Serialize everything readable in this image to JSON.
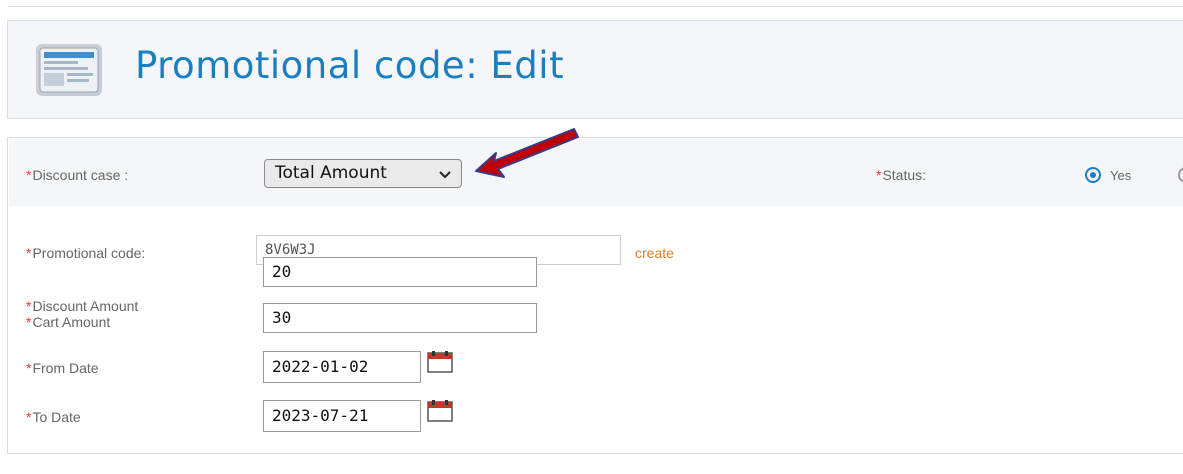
{
  "header": {
    "title": "Promotional code: Edit",
    "icon": "form-page-icon"
  },
  "form": {
    "required_marker": "*",
    "discount_case": {
      "label": "Discount case :",
      "selected": "Total Amount"
    },
    "status": {
      "label": "Status:",
      "options": [
        "Yes"
      ],
      "selected": "Yes"
    },
    "promo_code": {
      "label": "Promotional code:",
      "value": "8V6W3J",
      "create_label": "create"
    },
    "discount_amount": {
      "label": "Discount Amount",
      "value": "20"
    },
    "cart_amount": {
      "label": "Cart Amount",
      "value": "30"
    },
    "from_date": {
      "label": "From Date",
      "value": "2022-01-02",
      "icon": "calendar-icon"
    },
    "to_date": {
      "label": "To Date",
      "value": "2023-07-21",
      "icon": "calendar-icon"
    }
  },
  "annotation": {
    "type": "arrow",
    "color": "#c00000"
  },
  "colors": {
    "accent": "#1a7fc1",
    "required": "#e43b3b",
    "link": "#e07b2a"
  }
}
